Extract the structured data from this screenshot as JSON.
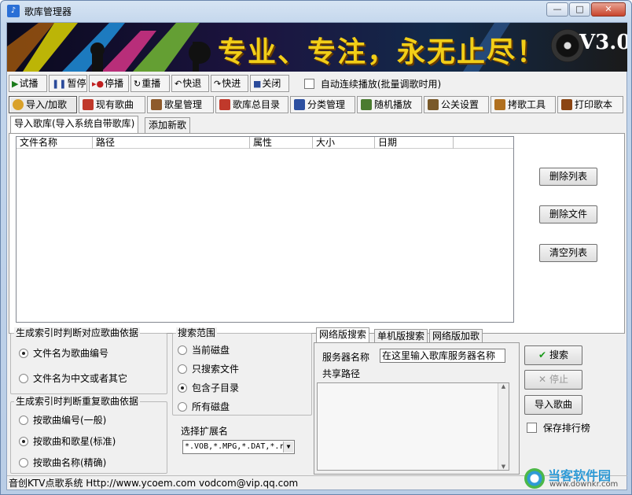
{
  "window": {
    "title": "歌库管理器",
    "min_label": "—",
    "max_label": "□",
    "close_label": "✕"
  },
  "banner": {
    "slogan": "专业、专注，永无止尽！",
    "version": "V3.0"
  },
  "toolbar": {
    "buttons": [
      {
        "icon": "play-icon",
        "label": "试播"
      },
      {
        "icon": "pause-icon",
        "label": "暂停"
      },
      {
        "icon": "stop-icon",
        "label": "停播"
      },
      {
        "icon": "replay-icon",
        "label": "重播"
      },
      {
        "icon": "rewind-icon",
        "label": "快退"
      },
      {
        "icon": "forward-icon",
        "label": "快进"
      },
      {
        "icon": "close-icon",
        "label": "关闭"
      }
    ],
    "auto_play_label": "自动连续播放(批量调歌时用)",
    "auto_play_checked": false
  },
  "tabs": [
    {
      "label": "导入/加歌",
      "active": true,
      "color": "#d9a12a"
    },
    {
      "label": "现有歌曲",
      "active": false,
      "color": "#c0392b"
    },
    {
      "label": "歌星管理",
      "active": false,
      "color": "#8e5a2b"
    },
    {
      "label": "歌库总目录",
      "active": false,
      "color": "#c0392b"
    },
    {
      "label": "分类管理",
      "active": false,
      "color": "#2c4fa0"
    },
    {
      "label": "随机播放",
      "active": false,
      "color": "#4a7b2f"
    },
    {
      "label": "公关设置",
      "active": false,
      "color": "#7a5a2a"
    },
    {
      "label": "拷歌工具",
      "active": false,
      "color": "#b07020"
    },
    {
      "label": "打印歌本",
      "active": false,
      "color": "#8b4513"
    }
  ],
  "subtabs": [
    {
      "label": "导入歌库(导入系统自带歌库)",
      "active": true
    },
    {
      "label": "添加新歌",
      "active": false
    }
  ],
  "list": {
    "columns": [
      "文件名称",
      "路径",
      "属性",
      "大小",
      "日期"
    ],
    "rows": []
  },
  "list_buttons": {
    "delete_list": "删除列表",
    "delete_file": "删除文件",
    "clear_list": "清空列表"
  },
  "index_group": {
    "title": "生成索引时判断对应歌曲依据",
    "options": [
      {
        "label": "文件名为歌曲编号",
        "checked": true
      },
      {
        "label": "文件名为中文或者其它",
        "checked": false
      }
    ]
  },
  "dup_group": {
    "title": "生成索引时判断重复歌曲依据",
    "options": [
      {
        "label": "按歌曲编号(一般)",
        "checked": false
      },
      {
        "label": "按歌曲和歌星(标准)",
        "checked": true
      },
      {
        "label": "按歌曲名称(精确)",
        "checked": false
      }
    ]
  },
  "search_group": {
    "title": "搜索范围",
    "options": [
      {
        "label": "当前磁盘",
        "checked": false
      },
      {
        "label": "只搜索文件",
        "checked": false
      },
      {
        "label": "包含子目录",
        "checked": true
      },
      {
        "label": "所有磁盘",
        "checked": false
      }
    ]
  },
  "ext": {
    "label": "选择扩展名",
    "value": "*.VOB,*.MPG,*.DAT,*.r"
  },
  "net_tabs": [
    {
      "label": "网络版搜索",
      "active": true
    },
    {
      "label": "单机版搜索",
      "active": false
    },
    {
      "label": "网络版加歌",
      "active": false
    }
  ],
  "net": {
    "server_label": "服务器名称",
    "server_value": "在这里输入歌库服务器名称",
    "share_label": "共享路径"
  },
  "actions": {
    "search": "搜索",
    "stop": "停止",
    "import": "导入歌曲",
    "save_rank_label": "保存排行榜",
    "save_rank_checked": false
  },
  "status": {
    "text": "音创KTV点歌系统 Http://www.ycoem.com vodcom@vip.qq.com"
  },
  "watermark": {
    "site": "当客软件园",
    "url": "www.downkr.com"
  }
}
